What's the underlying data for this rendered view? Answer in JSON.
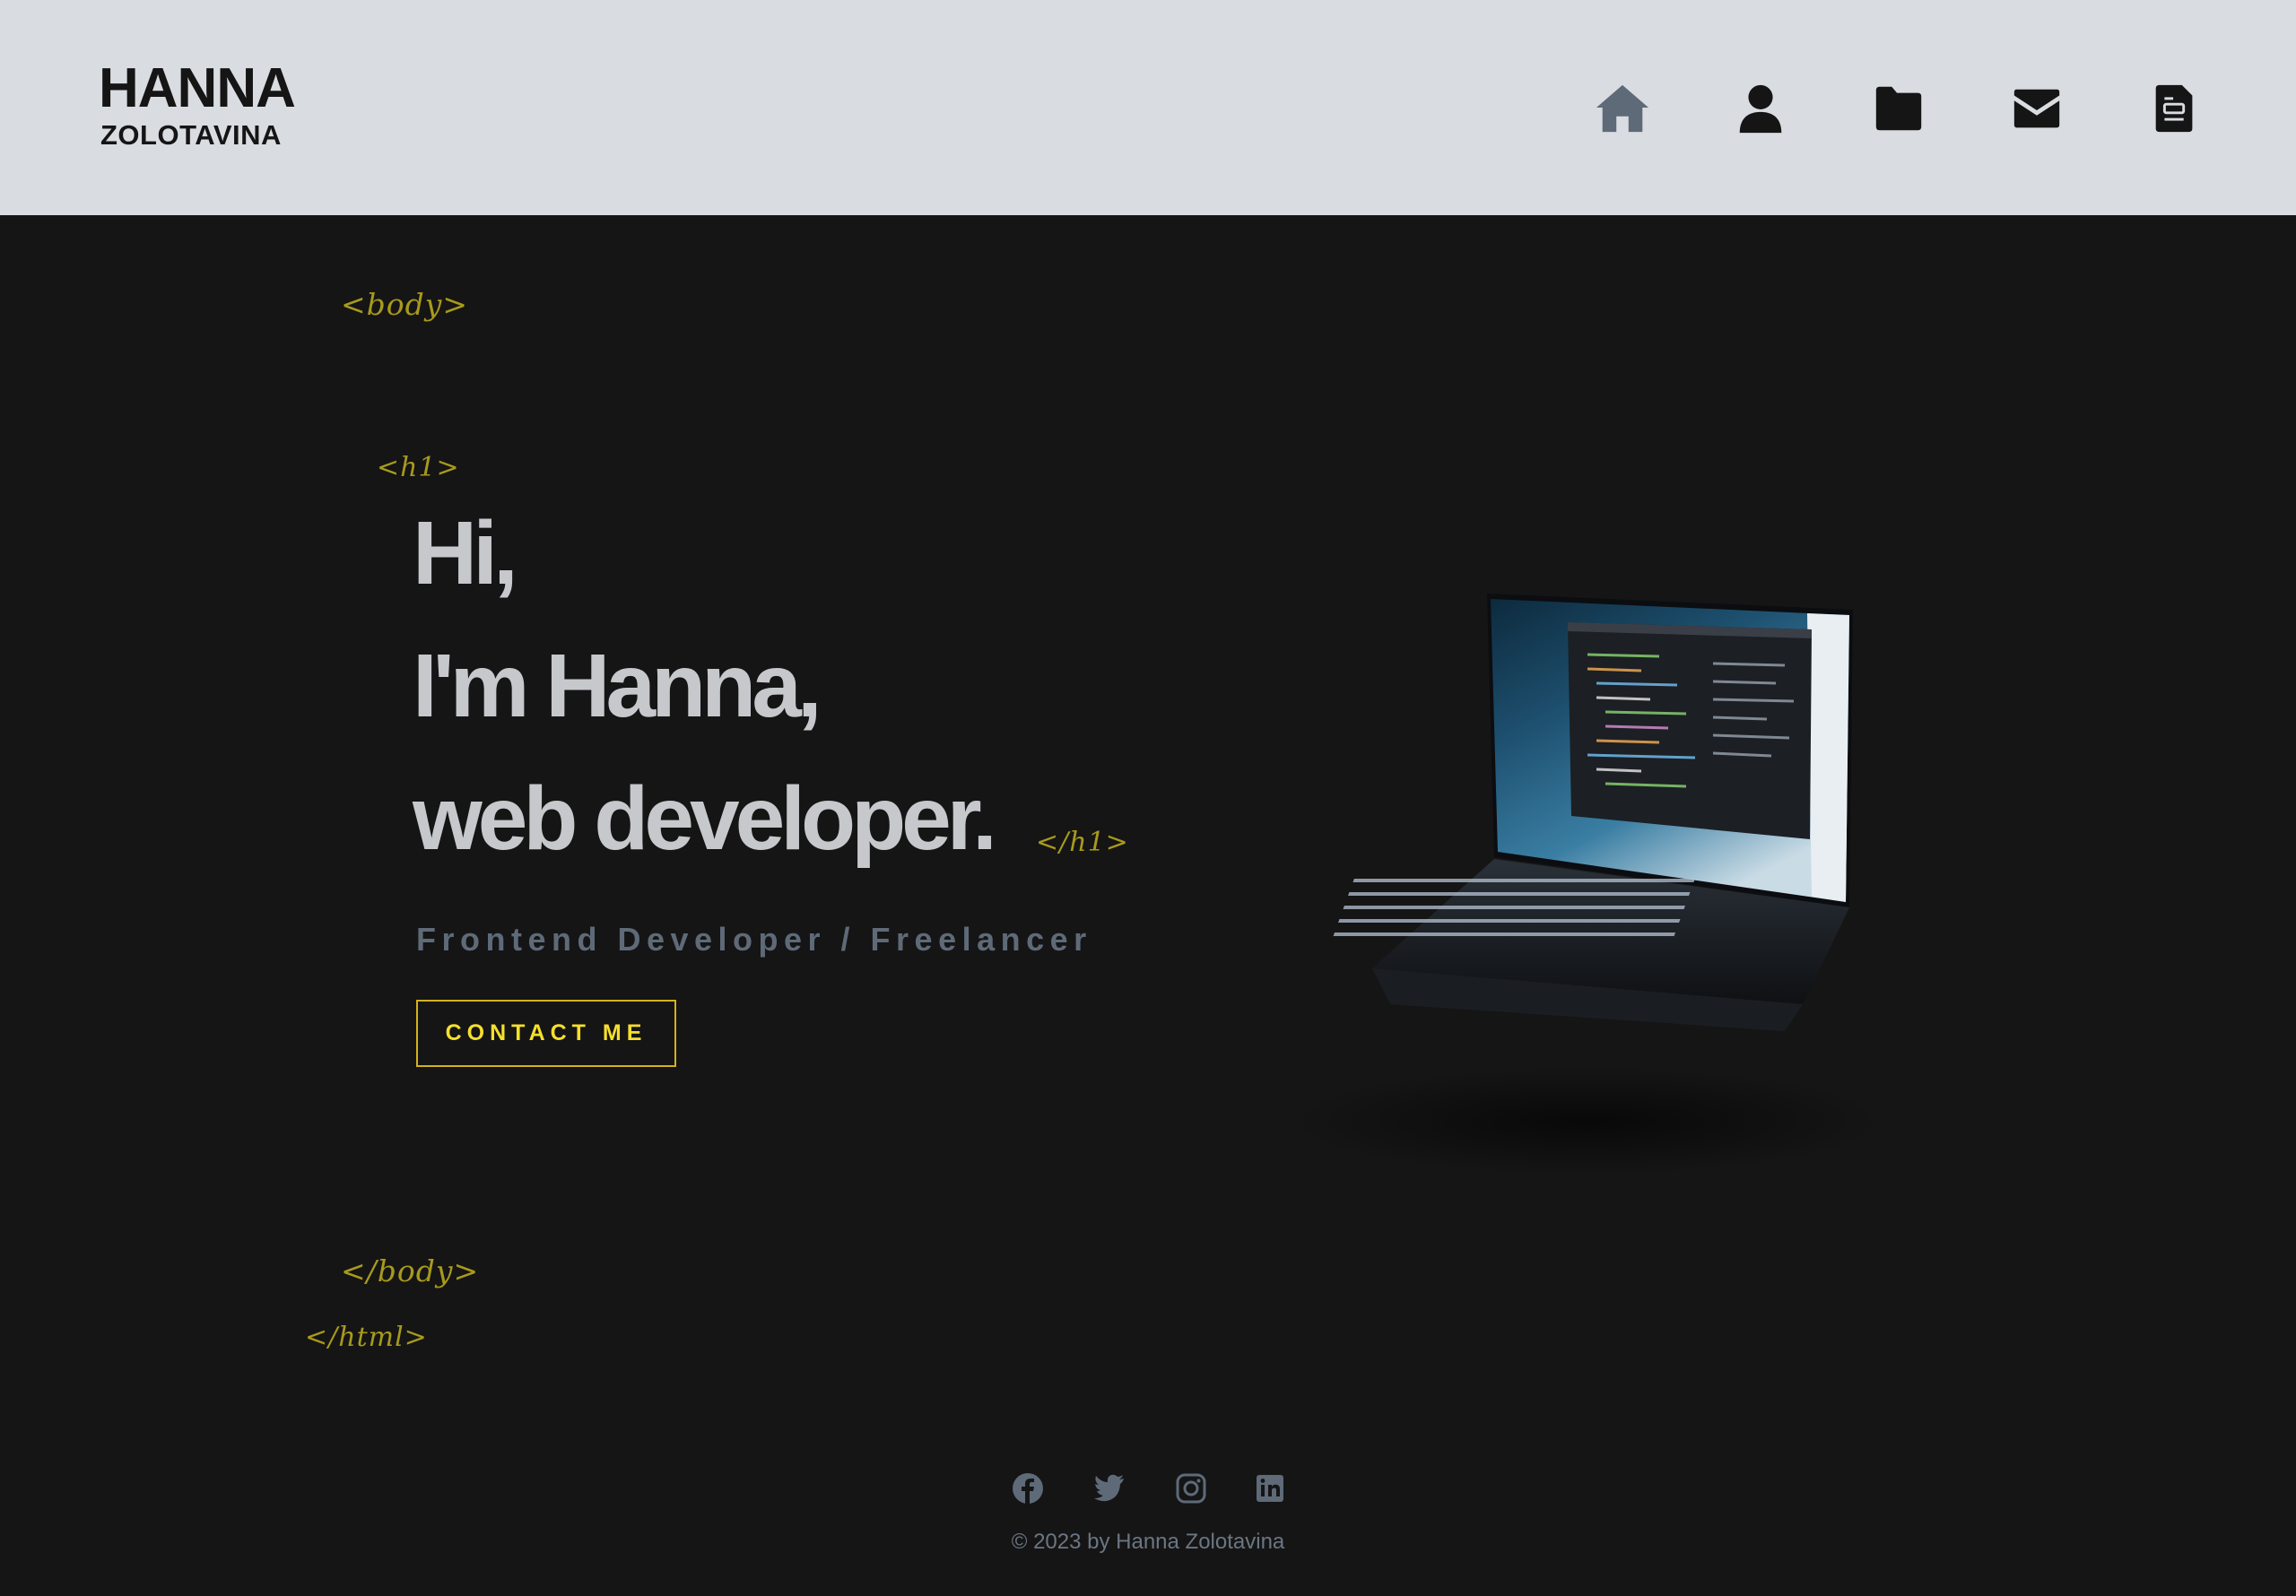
{
  "logo": {
    "top": "HANNA",
    "bottom": "ZOLOTAVINA"
  },
  "nav": [
    {
      "icon": "home-icon",
      "label": "Home",
      "active": true
    },
    {
      "icon": "user-icon",
      "label": "About"
    },
    {
      "icon": "folder-icon",
      "label": "Portfolio"
    },
    {
      "icon": "envelope-icon",
      "label": "Contact"
    },
    {
      "icon": "document-icon",
      "label": "Resume"
    }
  ],
  "tags": {
    "body_open": "<body>",
    "h1_open": "<h1>",
    "h1_close": "</h1>",
    "body_close": "</body>",
    "html_close": "</html>"
  },
  "hero": {
    "line1": "Hi,",
    "line2": "I'm Hanna,",
    "line3": "web developer.",
    "subtitle": "Frontend Developer / Freelancer",
    "cta": "CONTACT ME"
  },
  "social": [
    {
      "icon": "facebook-icon"
    },
    {
      "icon": "twitter-icon"
    },
    {
      "icon": "instagram-icon"
    },
    {
      "icon": "linkedin-icon"
    }
  ],
  "footer": {
    "copyright": "© 2023 by Hanna Zolotavina"
  },
  "colors": {
    "background": "#151515",
    "header": "#d9dce1",
    "accent": "#f5df2c",
    "tag": "#a89a1b",
    "hero_text": "#c7c8cc",
    "nav_active": "#5e6a78",
    "nav_icon": "#151515"
  }
}
